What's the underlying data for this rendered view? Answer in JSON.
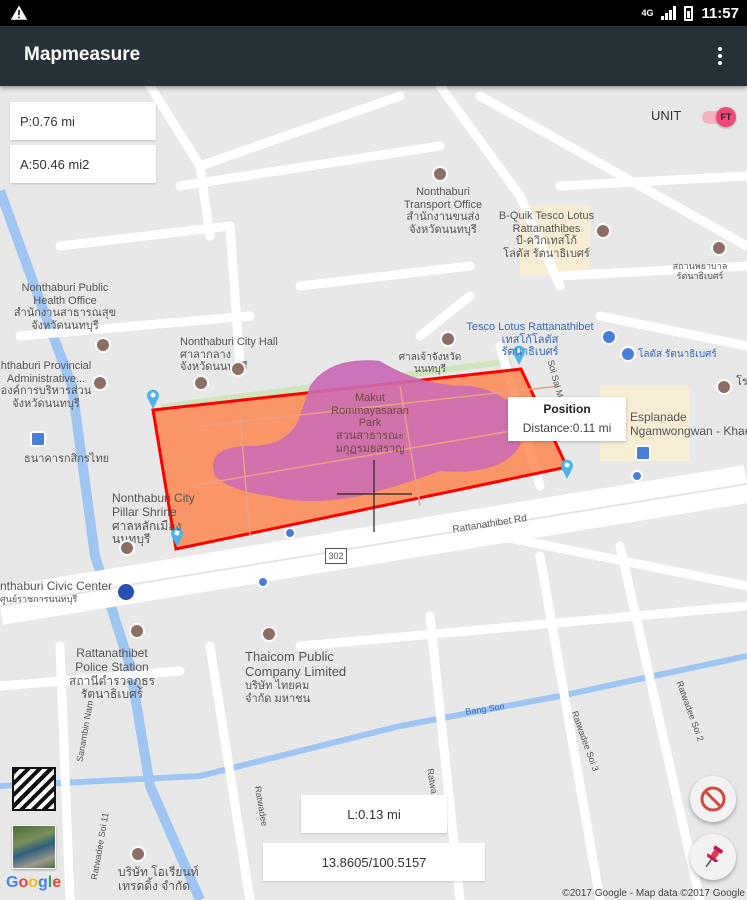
{
  "status_bar": {
    "time": "11:57",
    "network": "4G"
  },
  "app_bar": {
    "title": "Mapmeasure",
    "menu_icon": "overflow-menu-icon"
  },
  "measurements": {
    "perimeter": "P:0.76 mi",
    "area": "A:50.46 mi2",
    "length": "L:0.13 mi",
    "coordinates": "13.8605/100.5157"
  },
  "unit": {
    "label": "UNIT",
    "toggle_value": "FT",
    "accent": "#ef4a79"
  },
  "callout": {
    "title": "Position",
    "distance": "Distance:0.11 mi"
  },
  "polygon": {
    "stroke": "#ff0000",
    "fill": "#ff7a3c"
  },
  "map_labels": {
    "transport_office": [
      "Nonthaburi",
      "Transport Office",
      "สำนักงานขนส่ง",
      "จังหวัดนนทบุรี"
    ],
    "bquik": [
      "B-Quik Tesco Lotus",
      "Rattanathibes",
      "บี-ควิกเทสโก้",
      "โลตัส รัตนาธิเบศร์"
    ],
    "hospital_th": "สถานพยาบาลรัตนาธิเบศร์",
    "public_health": [
      "Nonthaburi Public",
      "Health Office",
      "สำนักงานสาธารณสุข",
      "จังหวัดนนทบุรี"
    ],
    "city_hall": [
      "Nonthaburi City Hall",
      "ศาลากลาง",
      "จังหวัดนนทบุรี"
    ],
    "th_label_1": "ศาลเจ้าจังหวัดนนทบุรี",
    "tesco_lotus": [
      "Tesco Lotus Rattanathibet",
      "เทสโก้โลตัส",
      "รัตนาธิเบศร์"
    ],
    "lotus_th": "โลตัส รัตนาธิเบศร์",
    "provincial_admin": [
      "hthaburi Provincial",
      "Administrative...",
      "องค์การบริหารส่วน",
      "จังหวัดนนทบุรี"
    ],
    "park": [
      "Makut",
      "Rommayasaran",
      "Park",
      "สวนสาธารณะ",
      "มกุฏรมยสราญ"
    ],
    "esplanade": [
      "Esplanade",
      "Ngamwongwan - Khae"
    ],
    "bank_th": "ธนาคารกสิกรไทย",
    "pillar_shrine": [
      "Nonthaburi City",
      "Pillar Shrine",
      "ศาลหลักเมืองนนทบุรี"
    ],
    "rattanathibet_rd": "Rattanathibet Rd",
    "route_302": "302",
    "civic_center": [
      "nthaburi Civic Center",
      "ศูนย์ราชการนนทบุรี"
    ],
    "police": [
      "Rattanathibet",
      "Police Station",
      "สถานีตำรวจภูธร",
      "รัตนาธิเบศร์"
    ],
    "thaicom": [
      "Thaicom Public",
      "Company Limited",
      "บริษัท ไทยคม",
      "จำกัด มหาชน"
    ],
    "bang_son": "Bang Son",
    "ratwadee_2": "Ratwadee Soi 2",
    "ratwadee_3": "Ratwadee Soi 3",
    "ratwadee_11": "Ratwadee Soi 11",
    "ratwadee": "Ratwadee",
    "ratwa": "Ratwa",
    "sanambin_nam": "Sanambin Nam",
    "bottom_company": [
      "บริษัท โอเรียนท์",
      "เทรดดิ้ง จำกัด"
    ],
    "sai_ma": "Soi Sai Ma",
    "right_edge_top": "สถานพยาบาลรัตนาธิเบศร์",
    "right_edge_mid": "โร"
  },
  "google": {
    "letters": [
      "G",
      "o",
      "o",
      "g",
      "l",
      "e"
    ]
  },
  "attribution": "©2017 Google - Map data ©2017 Google"
}
